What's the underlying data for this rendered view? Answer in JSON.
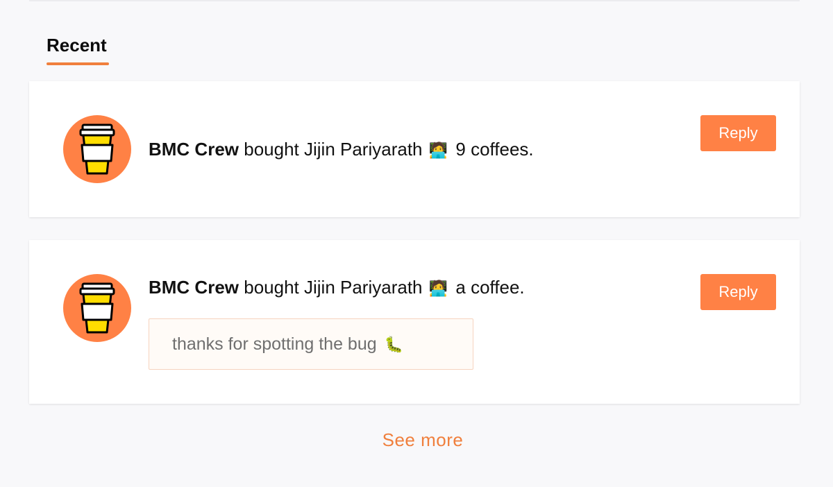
{
  "section": {
    "tab_label": "Recent"
  },
  "accent_color": "#ff8145",
  "feed": [
    {
      "avatar_icon": "coffee-cup-icon",
      "actor": "BMC Crew",
      "action": "bought Jijin Pariyarath",
      "emoji": "🧑‍💻",
      "object": "9 coffees.",
      "reply_label": "Reply"
    },
    {
      "avatar_icon": "coffee-cup-icon",
      "actor": "BMC Crew",
      "action": "bought Jijin Pariyarath",
      "emoji": "🧑‍💻",
      "object": "a coffee.",
      "note": "thanks for spotting the bug",
      "note_emoji": "🐛",
      "reply_label": "Reply"
    }
  ],
  "see_more_label": "See more"
}
